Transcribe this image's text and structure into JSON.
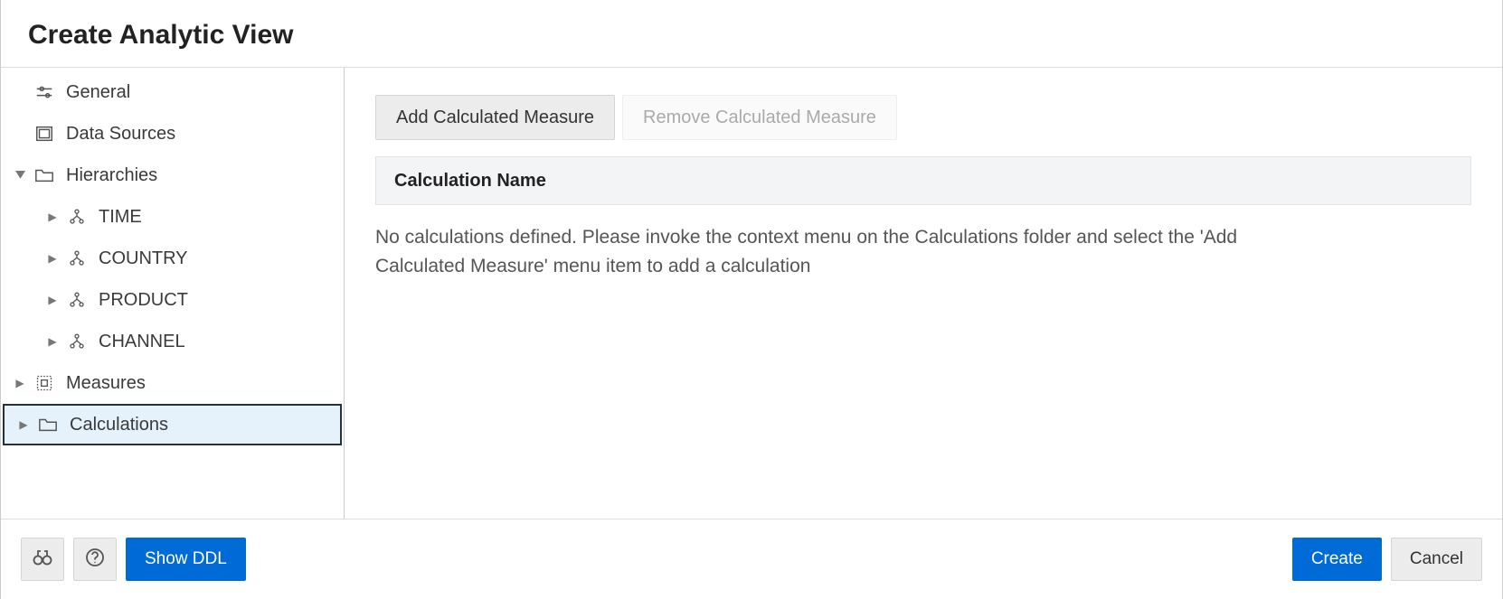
{
  "header": {
    "title": "Create Analytic View"
  },
  "sidebar": {
    "general": "General",
    "data_sources": "Data Sources",
    "hierarchies": "Hierarchies",
    "hier_items": [
      "TIME",
      "COUNTRY",
      "PRODUCT",
      "CHANNEL"
    ],
    "measures": "Measures",
    "calculations": "Calculations"
  },
  "main": {
    "add_btn": "Add Calculated Measure",
    "remove_btn": "Remove Calculated Measure",
    "col_header": "Calculation Name",
    "empty_text": "No calculations defined. Please invoke the context menu on the Calculations folder and select the 'Add Calculated Measure' menu item to add a calculation"
  },
  "footer": {
    "show_ddl": "Show DDL",
    "create": "Create",
    "cancel": "Cancel"
  }
}
